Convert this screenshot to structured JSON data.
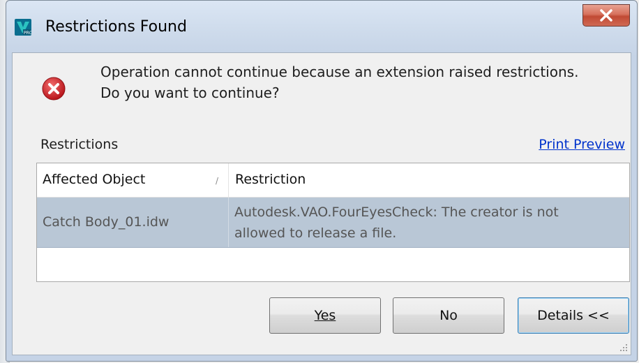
{
  "window": {
    "title": "Restrictions Found",
    "close_glyph": "X"
  },
  "message": {
    "line1": "Operation cannot continue because an extension raised restrictions.",
    "line2": "Do you want to continue?"
  },
  "restrictions": {
    "label": "Restrictions",
    "print_preview": "Print Preview",
    "columns": [
      "Affected Object",
      "Restriction"
    ],
    "sort_glyph": "/",
    "rows": [
      {
        "object": "Catch Body_01.idw",
        "restriction": "Autodesk.VAO.FourEyesCheck: The creator is not allowed to release a file."
      }
    ]
  },
  "buttons": {
    "yes_label": "Yes",
    "no_label": "No",
    "details_label": "Details <<"
  },
  "icons": {
    "app": "autodesk-vault-icon",
    "error": "error-icon",
    "close": "close-icon"
  },
  "colors": {
    "selected_row": "#b9c7d6",
    "link": "#0033cc",
    "error_red": "#d8262a",
    "close_button": "#c14a34"
  }
}
